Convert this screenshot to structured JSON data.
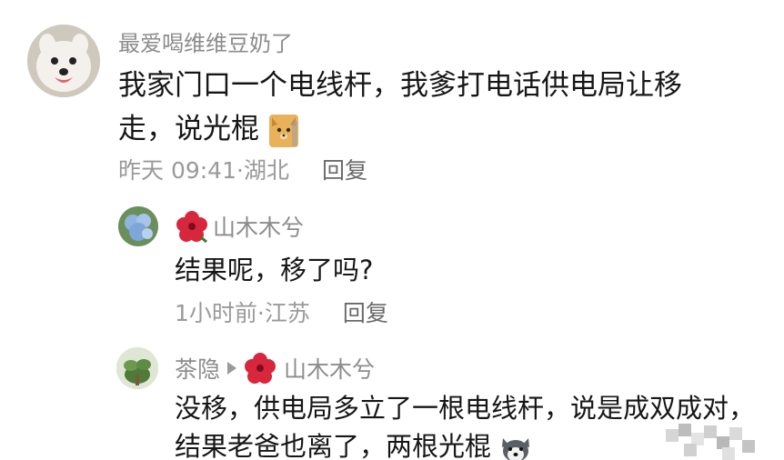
{
  "comments": [
    {
      "author": "最爱喝维维豆奶了",
      "text": "我家门口一个电线杆，我爹打电话供电局让移走，说光棍",
      "time": "昨天 09:41",
      "location": "湖北",
      "reply_label": "回复",
      "avatar_icon": "samoyed-dog-avatar",
      "trailing_emoji": "dog-face-emoji"
    },
    {
      "author": "山木木兮",
      "author_badge_icon": "hibiscus-flower-icon",
      "text": "结果呢，移了吗?",
      "time": "1小时前",
      "location": "江苏",
      "reply_label": "回复",
      "avatar_icon": "hydrangea-flower-avatar"
    },
    {
      "author": "茶隐",
      "reply_to": "山木木兮",
      "reply_to_badge_icon": "hibiscus-flower-icon",
      "text": "没移，供电局多立了一根电线杆，说是成双成对，结果老爸也离了，两根光棍",
      "avatar_icon": "plant-avatar",
      "trailing_emoji": "husky-dog-emoji"
    }
  ],
  "separator": "·",
  "colors": {
    "name": "#8c8c8c",
    "body_text": "#161616",
    "meta": "#9a9a9a",
    "flower": "#d8263c"
  }
}
